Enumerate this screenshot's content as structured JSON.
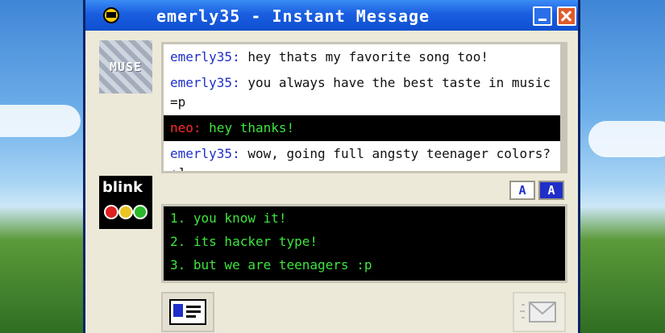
{
  "window": {
    "title": "emerly35 - Instant Message",
    "accent": "#1a5ee0"
  },
  "buddy": {
    "avatar_text": "MUSE"
  },
  "me": {
    "avatar_text": "blink"
  },
  "messages": [
    {
      "sender": "emerly35:",
      "text": "hey thats my favorite song too!",
      "highlight": false
    },
    {
      "sender": "emerly35:",
      "text": "you always have the best taste in music =p",
      "highlight": false
    },
    {
      "sender": "neo:",
      "text": "hey thanks!",
      "highlight": true
    },
    {
      "sender": "emerly35:",
      "text": "wow, going full angsty teenager colors? ;]",
      "highlight": false
    }
  ],
  "format_buttons": [
    {
      "label": "A",
      "icon": "font-icon"
    },
    {
      "label": "A",
      "icon": "font-color-icon"
    }
  ],
  "compose": {
    "lines": [
      "1. you know it!",
      "2. its hacker type!",
      "3. but we are teenagers :p"
    ]
  },
  "colors": {
    "buddy_name": "#1f2fc8",
    "my_name": "#ff2a2a",
    "highlight_text": "#3ee53e"
  }
}
